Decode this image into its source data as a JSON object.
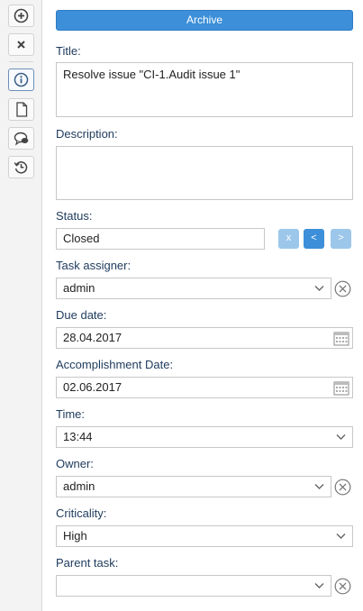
{
  "toolbar": {
    "tools": [
      {
        "icon": "plus-circle-icon"
      },
      {
        "icon": "close-icon"
      },
      {
        "icon": "info-icon"
      },
      {
        "icon": "document-icon"
      },
      {
        "icon": "comment-icon"
      },
      {
        "icon": "history-icon"
      }
    ]
  },
  "form": {
    "archive_label": "Archive",
    "title_label": "Title:",
    "title_value": "Resolve issue \"CI-1.Audit issue 1\"",
    "description_label": "Description:",
    "description_value": "",
    "status_label": "Status:",
    "status_value": "Closed",
    "status_buttons": {
      "reset": "x",
      "prev": "<",
      "next": ">"
    },
    "task_assigner_label": "Task assigner:",
    "task_assigner_value": "admin",
    "due_date_label": "Due date:",
    "due_date_value": "28.04.2017",
    "accomplishment_label": "Accomplishment Date:",
    "accomplishment_value": "02.06.2017",
    "time_label": "Time:",
    "time_value": "13:44",
    "owner_label": "Owner:",
    "owner_value": "admin",
    "criticality_label": "Criticality:",
    "criticality_value": "High",
    "parent_task_label": "Parent task:",
    "parent_task_value": ""
  },
  "colors": {
    "primary": "#3c8fd8",
    "primary_light": "#9cc7ea",
    "label_text": "#1d3a5c",
    "border": "#c7c7c7"
  }
}
